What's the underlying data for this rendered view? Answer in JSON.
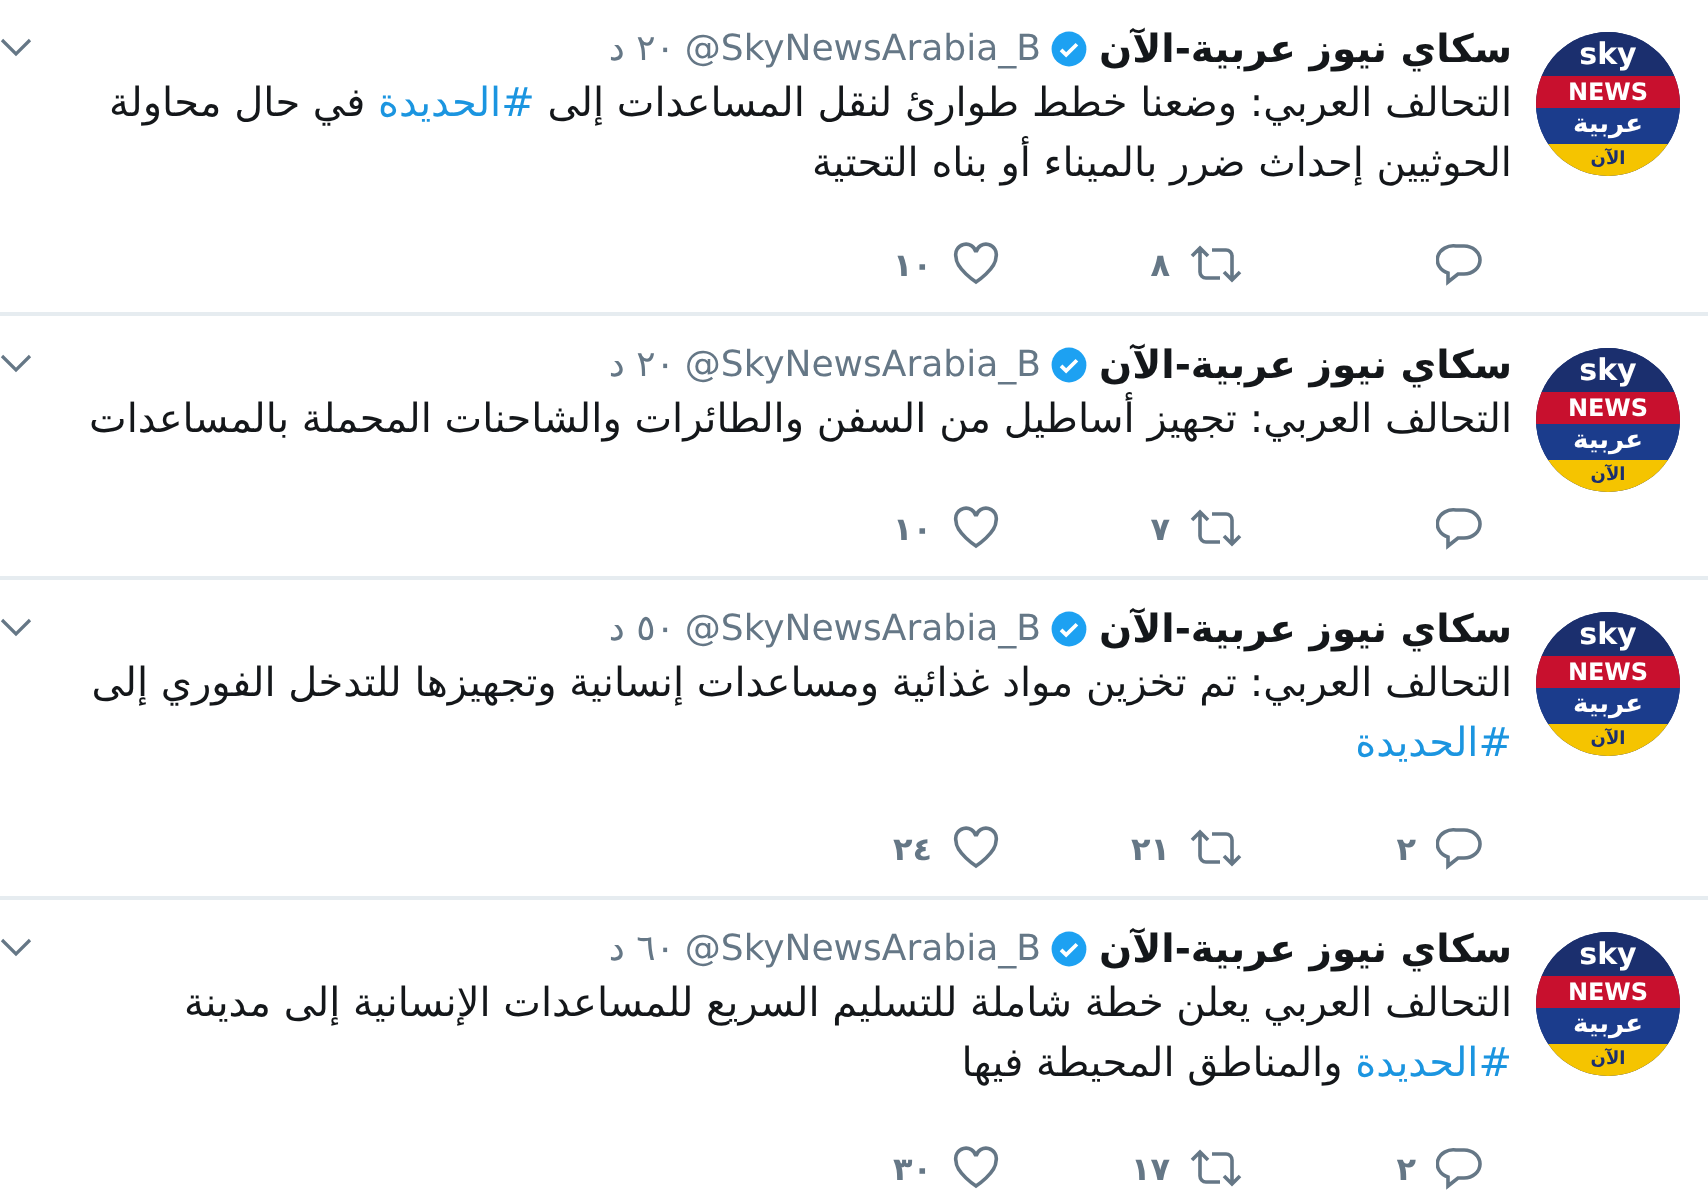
{
  "tweets": [
    {
      "avatar": [
        "sky",
        "NEWS",
        "عربية",
        "الآن"
      ],
      "name": "سكاي نيوز عربية-الآن",
      "verified": true,
      "handle": "@SkyNewsArabia_B",
      "time": "٢٠ د",
      "lines": [
        [
          {
            "kind": "text",
            "text": "التحالف العربي: وضعنا خطط طوارئ لنقل المساعدات إلى "
          },
          {
            "kind": "hashtag",
            "text": "#الحديدة"
          },
          {
            "kind": "text",
            "text": " في حال محاولة"
          }
        ],
        [
          {
            "kind": "text",
            "text": "الحوثيين إحداث ضرر بالميناء أو بناه التحتية"
          }
        ]
      ],
      "retweets": "٨",
      "likes": "١٠"
    },
    {
      "avatar": [
        "sky",
        "NEWS",
        "عربية",
        "الآن"
      ],
      "name": "سكاي نيوز عربية-الآن",
      "verified": true,
      "handle": "@SkyNewsArabia_B",
      "time": "٢٠ د",
      "lines": [
        [
          {
            "kind": "text",
            "text": "التحالف العربي: تجهيز أساطيل من السفن والطائرات والشاحنات المحملة بالمساعدات"
          }
        ]
      ],
      "retweets": "٧",
      "likes": "١٠"
    },
    {
      "avatar": [
        "sky",
        "NEWS",
        "عربية",
        "الآن"
      ],
      "name": "سكاي نيوز عربية-الآن",
      "verified": true,
      "handle": "@SkyNewsArabia_B",
      "time": "٥٠ د",
      "lines": [
        [
          {
            "kind": "text",
            "text": "التحالف العربي: تم تخزين مواد غذائية ومساعدات إنسانية وتجهيزها للتدخل الفوري إلى"
          }
        ],
        [
          {
            "kind": "hashtag",
            "text": "#الحديدة"
          }
        ]
      ],
      "replies": "٢",
      "retweets": "٢١",
      "likes": "٢٤"
    },
    {
      "avatar": [
        "sky",
        "NEWS",
        "عربية",
        "الآن"
      ],
      "name": "سكاي نيوز عربية-الآن",
      "verified": true,
      "handle": "@SkyNewsArabia_B",
      "time": "٦٠ د",
      "lines": [
        [
          {
            "kind": "text",
            "text": "التحالف العربي يعلن خطة شاملة للتسليم السريع للمساعدات الإنسانية إلى مدينة"
          }
        ],
        [
          {
            "kind": "hashtag",
            "text": "#الحديدة"
          },
          {
            "kind": "text",
            "text": " والمناطق المحيطة فيها"
          }
        ]
      ],
      "replies": "٢",
      "retweets": "١٧",
      "likes": "٣٠"
    }
  ]
}
